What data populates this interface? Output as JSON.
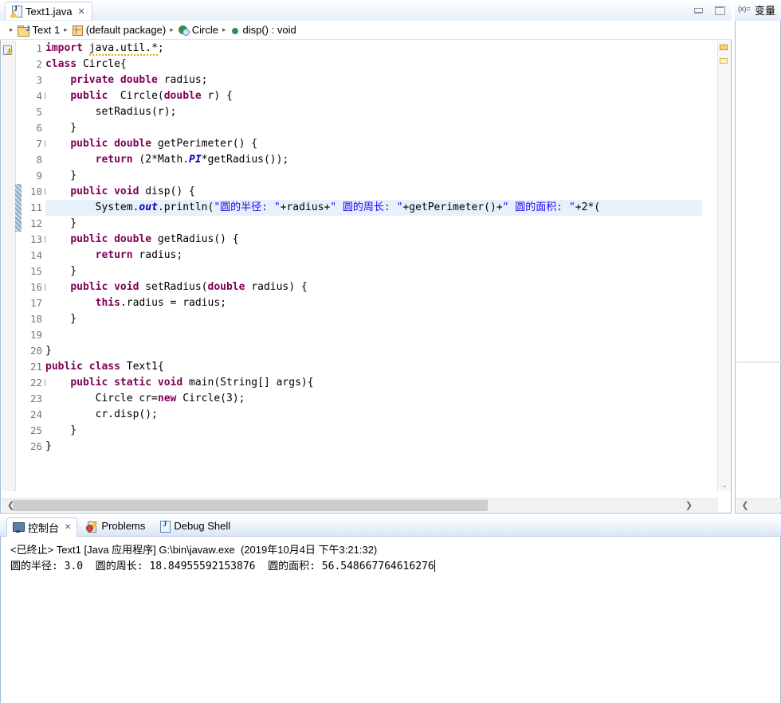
{
  "window": {
    "minimize_label": "Minimize",
    "maximize_label": "Maximize"
  },
  "editor": {
    "tab": {
      "icon": "java-file-warning-icon",
      "title": "Text1.java",
      "close": "✕"
    },
    "breadcrumb": [
      {
        "icon": "java-project-icon",
        "label": "Text 1"
      },
      {
        "icon": "package-icon",
        "label": "(default package)"
      },
      {
        "icon": "class-icon",
        "label": "Circle"
      },
      {
        "icon": "method-icon",
        "label": "disp() : void"
      }
    ],
    "breadcrumb_separator": "▸",
    "current_line": 11,
    "fold_lines": [
      4,
      7,
      10,
      13,
      16,
      22
    ],
    "warning_line": 1,
    "change_bar_lines": [
      10,
      11,
      12
    ],
    "lines": [
      {
        "n": 1,
        "tokens": [
          {
            "t": "kw",
            "v": "import"
          },
          {
            "t": "plain",
            "v": " "
          },
          {
            "t": "sq",
            "v": "java.util.*"
          },
          {
            "t": "plain",
            "v": ";"
          }
        ]
      },
      {
        "n": 2,
        "tokens": [
          {
            "t": "kw",
            "v": "class"
          },
          {
            "t": "plain",
            "v": " Circle{"
          }
        ]
      },
      {
        "n": 3,
        "tokens": [
          {
            "t": "plain",
            "v": "    "
          },
          {
            "t": "kw",
            "v": "private double"
          },
          {
            "t": "plain",
            "v": " radius;"
          }
        ]
      },
      {
        "n": 4,
        "tokens": [
          {
            "t": "plain",
            "v": "    "
          },
          {
            "t": "kw",
            "v": "public"
          },
          {
            "t": "plain",
            "v": "  Circle("
          },
          {
            "t": "kw",
            "v": "double"
          },
          {
            "t": "plain",
            "v": " r) {"
          }
        ]
      },
      {
        "n": 5,
        "tokens": [
          {
            "t": "plain",
            "v": "        setRadius(r);"
          }
        ]
      },
      {
        "n": 6,
        "tokens": [
          {
            "t": "plain",
            "v": "    }"
          }
        ]
      },
      {
        "n": 7,
        "tokens": [
          {
            "t": "plain",
            "v": "    "
          },
          {
            "t": "kw",
            "v": "public double"
          },
          {
            "t": "plain",
            "v": " getPerimeter() {"
          }
        ]
      },
      {
        "n": 8,
        "tokens": [
          {
            "t": "plain",
            "v": "        "
          },
          {
            "t": "kw",
            "v": "return"
          },
          {
            "t": "plain",
            "v": " (2*Math."
          },
          {
            "t": "stat",
            "v": "PI"
          },
          {
            "t": "plain",
            "v": "*getRadius());"
          }
        ]
      },
      {
        "n": 9,
        "tokens": [
          {
            "t": "plain",
            "v": "    }"
          }
        ]
      },
      {
        "n": 10,
        "tokens": [
          {
            "t": "plain",
            "v": "    "
          },
          {
            "t": "kw",
            "v": "public void"
          },
          {
            "t": "plain",
            "v": " disp() {"
          }
        ]
      },
      {
        "n": 11,
        "tokens": [
          {
            "t": "plain",
            "v": "        System."
          },
          {
            "t": "stat",
            "v": "out"
          },
          {
            "t": "plain",
            "v": ".println("
          },
          {
            "t": "str",
            "v": "\"圆的半径: \""
          },
          {
            "t": "plain",
            "v": "+radius+"
          },
          {
            "t": "str",
            "v": "\" 圆的周长: \""
          },
          {
            "t": "plain",
            "v": "+getPerimeter()+"
          },
          {
            "t": "str",
            "v": "\" 圆的面积: \""
          },
          {
            "t": "plain",
            "v": "+2*("
          }
        ]
      },
      {
        "n": 12,
        "tokens": [
          {
            "t": "plain",
            "v": "    }"
          }
        ]
      },
      {
        "n": 13,
        "tokens": [
          {
            "t": "plain",
            "v": "    "
          },
          {
            "t": "kw",
            "v": "public double"
          },
          {
            "t": "plain",
            "v": " getRadius() {"
          }
        ]
      },
      {
        "n": 14,
        "tokens": [
          {
            "t": "plain",
            "v": "        "
          },
          {
            "t": "kw",
            "v": "return"
          },
          {
            "t": "plain",
            "v": " radius;"
          }
        ]
      },
      {
        "n": 15,
        "tokens": [
          {
            "t": "plain",
            "v": "    }"
          }
        ]
      },
      {
        "n": 16,
        "tokens": [
          {
            "t": "plain",
            "v": "    "
          },
          {
            "t": "kw",
            "v": "public void"
          },
          {
            "t": "plain",
            "v": " setRadius("
          },
          {
            "t": "kw",
            "v": "double"
          },
          {
            "t": "plain",
            "v": " radius) {"
          }
        ]
      },
      {
        "n": 17,
        "tokens": [
          {
            "t": "plain",
            "v": "        "
          },
          {
            "t": "kw",
            "v": "this"
          },
          {
            "t": "plain",
            "v": ".radius = radius;"
          }
        ]
      },
      {
        "n": 18,
        "tokens": [
          {
            "t": "plain",
            "v": "    }"
          }
        ]
      },
      {
        "n": 19,
        "tokens": [
          {
            "t": "plain",
            "v": ""
          }
        ]
      },
      {
        "n": 20,
        "tokens": [
          {
            "t": "plain",
            "v": "}"
          }
        ]
      },
      {
        "n": 21,
        "tokens": [
          {
            "t": "kw",
            "v": "public class"
          },
          {
            "t": "plain",
            "v": " Text1{"
          }
        ]
      },
      {
        "n": 22,
        "tokens": [
          {
            "t": "plain",
            "v": "    "
          },
          {
            "t": "kw",
            "v": "public static void"
          },
          {
            "t": "plain",
            "v": " main(String[] args){"
          }
        ]
      },
      {
        "n": 23,
        "tokens": [
          {
            "t": "plain",
            "v": "        Circle cr="
          },
          {
            "t": "kw",
            "v": "new"
          },
          {
            "t": "plain",
            "v": " Circle(3);"
          }
        ]
      },
      {
        "n": 24,
        "tokens": [
          {
            "t": "plain",
            "v": "        cr.disp();"
          }
        ]
      },
      {
        "n": 25,
        "tokens": [
          {
            "t": "plain",
            "v": "    }"
          }
        ]
      },
      {
        "n": 26,
        "tokens": [
          {
            "t": "plain",
            "v": "}"
          }
        ]
      }
    ],
    "scroll": {
      "up_arrow": "⌃",
      "down_arrow": "⌄",
      "left_arrow": "❮",
      "right_arrow": "❯"
    }
  },
  "right_view": {
    "tab_icon": "variables-icon",
    "tab_icon_text": "(x)=",
    "tab_label": "变量",
    "left_arrow": "❮"
  },
  "console": {
    "tabs": [
      {
        "icon": "console-icon",
        "label": "控制台",
        "active": true,
        "close": "✕"
      },
      {
        "icon": "problems-icon",
        "label": "Problems",
        "active": false,
        "close": ""
      },
      {
        "icon": "debug-shell-icon",
        "label": "Debug Shell",
        "active": false,
        "close": ""
      }
    ],
    "status_line": "<已终止> Text1 [Java 应用程序] G:\\bin\\javaw.exe  (2019年10月4日 下午3:21:32)",
    "output_lines": [
      "圆的半径: 3.0  圆的周长: 18.84955592153876  圆的面积: 56.548667764616276"
    ]
  },
  "colors": {
    "keyword": "#7f0055",
    "string": "#2a00ff",
    "static_field": "#0000c0",
    "current_line_bg": "#e8f0fb",
    "tab_border": "#b6c8dc"
  }
}
